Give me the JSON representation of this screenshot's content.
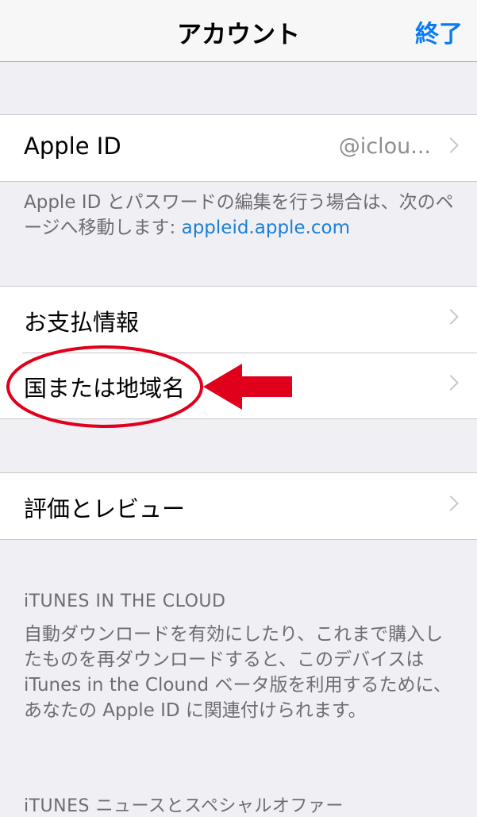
{
  "navbar": {
    "title": "アカウント",
    "done_label": "終了"
  },
  "apple_id": {
    "label": "Apple ID",
    "value": "@iclou...",
    "footer_text": "Apple ID とパスワードの編集を行う場合は、次のページへ移動します: ",
    "footer_link": "appleid.apple.com"
  },
  "payment_group": {
    "payment_label": "お支払情報",
    "country_label": "国または地域名"
  },
  "ratings": {
    "label": "評価とレビュー"
  },
  "itunes_cloud": {
    "header": "iTUNES IN THE CLOUD",
    "description": "自動ダウンロードを有効にしたり、これまで購入したものを再ダウンロードすると、このデバイスは iTunes in the Clound ベータ版を利用するために、あなたの Apple ID に関連付けられます。"
  },
  "itunes_news": {
    "header": "iTUNES ニュースとスペシャルオファー"
  },
  "colors": {
    "accent": "#0a7bf4",
    "annotation_red": "#e0001b",
    "background": "#efeff4"
  },
  "icons": {
    "chevron": "chevron-right-icon",
    "arrow": "arrow-left-icon"
  }
}
